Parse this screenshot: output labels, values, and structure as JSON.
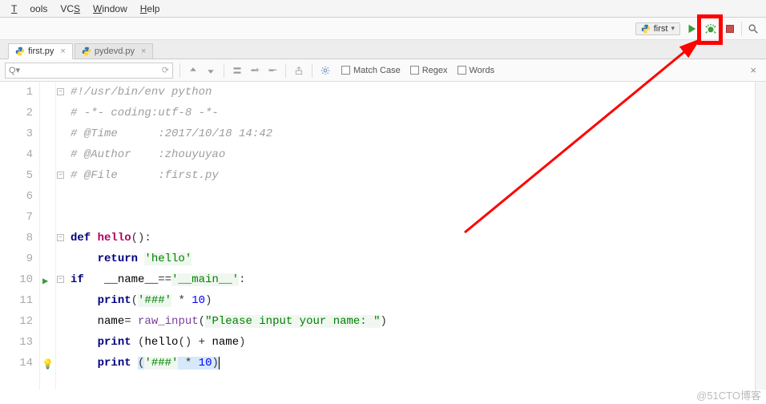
{
  "menu": {
    "tools": "Tools",
    "vcs": "VCS",
    "window": "Window",
    "help": "Help"
  },
  "run": {
    "config_name": "first"
  },
  "tabs": [
    {
      "name": "first.py",
      "active": true
    },
    {
      "name": "pydevd.py",
      "active": false
    }
  ],
  "search": {
    "placeholder": "Q▾",
    "match_case": "Match Case",
    "regex": "Regex",
    "words": "Words"
  },
  "code_lines": {
    "l1": "#!/usr/bin/env python",
    "l2": "# -*- coding:utf-8 -*-",
    "l3": "# @Time      :2017/10/18 14:42",
    "l4": "# @Author    :zhouyuyao",
    "l5": "# @File      :first.py",
    "l8_def": "def ",
    "l8_fn": "hello",
    "l8_rest": "():",
    "l9_kw": "return ",
    "l9_str": "'hello'",
    "l10_if": "if ",
    "l10_name1": "__name__",
    "l10_eq": "==",
    "l10_str": "'__main__'",
    "l10_colon": ":",
    "l11_kw": "print",
    "l11_open": "(",
    "l11_str": "'###'",
    "l11_mul": " * ",
    "l11_num": "10",
    "l11_close": ")",
    "l12_name": "name",
    "l12_eq": "= ",
    "l12_raw": "raw_input",
    "l12_open": "(",
    "l12_str": "\"Please input your name: \"",
    "l12_close": ")",
    "l13_kw": "print ",
    "l13_open": "(",
    "l13_fn": "hello",
    "l13_call": "()",
    "l13_plus": " + ",
    "l13_name": "name",
    "l13_close": ")",
    "l14_kw": "print ",
    "l14_open": "(",
    "l14_str": "'###'",
    "l14_mul": " * ",
    "l14_num": "10",
    "l14_close": ")"
  },
  "line_numbers": [
    "1",
    "2",
    "3",
    "4",
    "5",
    "6",
    "7",
    "8",
    "9",
    "10",
    "11",
    "12",
    "13",
    "14"
  ],
  "watermark": "@51CTO博客"
}
